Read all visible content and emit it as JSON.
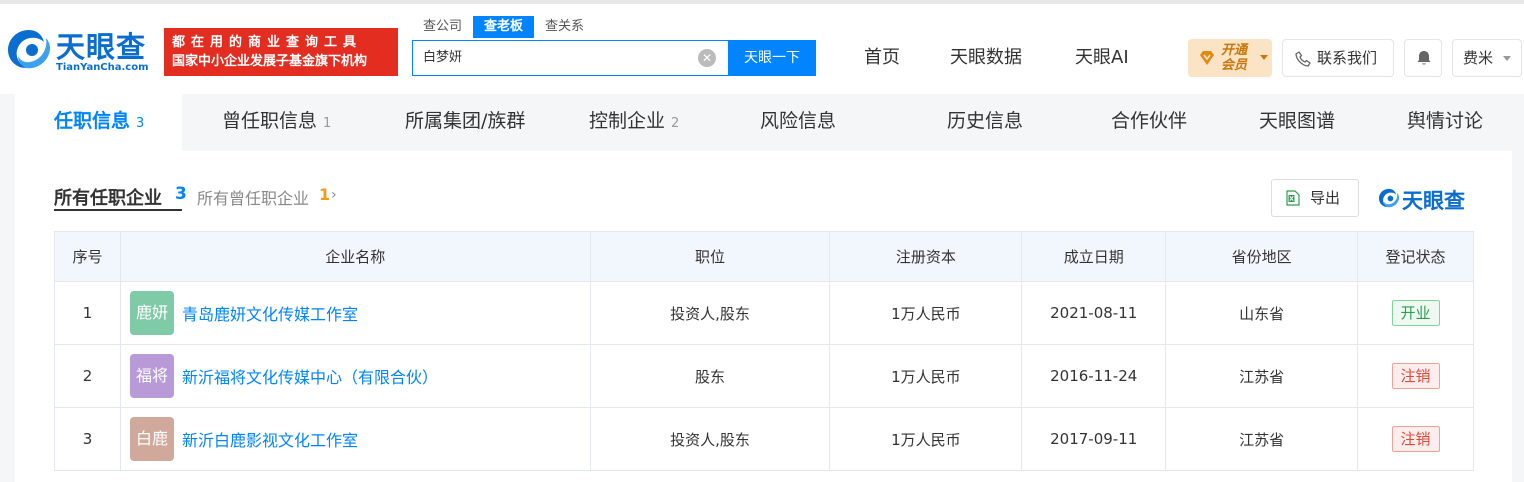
{
  "header": {
    "logo_text": "天眼查",
    "logo_sub": "TianYanCha.com",
    "slogan_line1": "都在用的商业查询工具",
    "slogan_line2": "国家中小企业发展子基金旗下机构",
    "search_tabs": [
      "查公司",
      "查老板",
      "查关系"
    ],
    "search_active_tab": "查老板",
    "search_value": "白梦妍",
    "search_button": "天眼一下",
    "nav": [
      "首页",
      "天眼数据",
      "天眼AI"
    ],
    "vip_label_line1": "开通",
    "vip_label_line2": "会员",
    "contact_label": "联系我们",
    "user_name": "费米"
  },
  "tabs": [
    {
      "label": "任职信息",
      "count": "3",
      "active": true
    },
    {
      "label": "曾任职信息",
      "count": "1",
      "active": false
    },
    {
      "label": "所属集团/族群",
      "count": "",
      "active": false
    },
    {
      "label": "控制企业",
      "count": "2",
      "active": false
    },
    {
      "label": "风险信息",
      "count": "",
      "active": false
    },
    {
      "label": "历史信息",
      "count": "",
      "active": false
    },
    {
      "label": "合作伙伴",
      "count": "",
      "active": false
    },
    {
      "label": "天眼图谱",
      "count": "",
      "active": false
    },
    {
      "label": "舆情讨论",
      "count": "",
      "active": false
    }
  ],
  "section": {
    "title": "所有任职企业",
    "count": "3",
    "link_label": "所有曾任职企业",
    "link_count": "1",
    "export_label": "导出",
    "brand_text": "天眼查"
  },
  "table": {
    "headers": [
      "序号",
      "企业名称",
      "职位",
      "注册资本",
      "成立日期",
      "省份地区",
      "登记状态"
    ],
    "rows": [
      {
        "index": "1",
        "avatar": "鹿妍",
        "avatar_color": "#7fcba8",
        "name": "青岛鹿妍文化传媒工作室",
        "position": "投资人,股东",
        "capital": "1万人民币",
        "date": "2021-08-11",
        "region": "山东省",
        "status": "开业",
        "status_type": "open"
      },
      {
        "index": "2",
        "avatar": "福将",
        "avatar_color": "#b89ad9",
        "name": "新沂福将文化传媒中心（有限合伙）",
        "position": "股东",
        "capital": "1万人民币",
        "date": "2016-11-24",
        "region": "江苏省",
        "status": "注销",
        "status_type": "closed"
      },
      {
        "index": "3",
        "avatar": "白鹿",
        "avatar_color": "#d1a99a",
        "name": "新沂白鹿影视文化工作室",
        "position": "投资人,股东",
        "capital": "1万人民币",
        "date": "2017-09-11",
        "region": "江苏省",
        "status": "注销",
        "status_type": "closed"
      }
    ]
  },
  "colors": {
    "primary": "#0084ff",
    "slogan_red": "#e32d21",
    "open_green": "#2e9e4f",
    "closed_red": "#e0483a"
  }
}
